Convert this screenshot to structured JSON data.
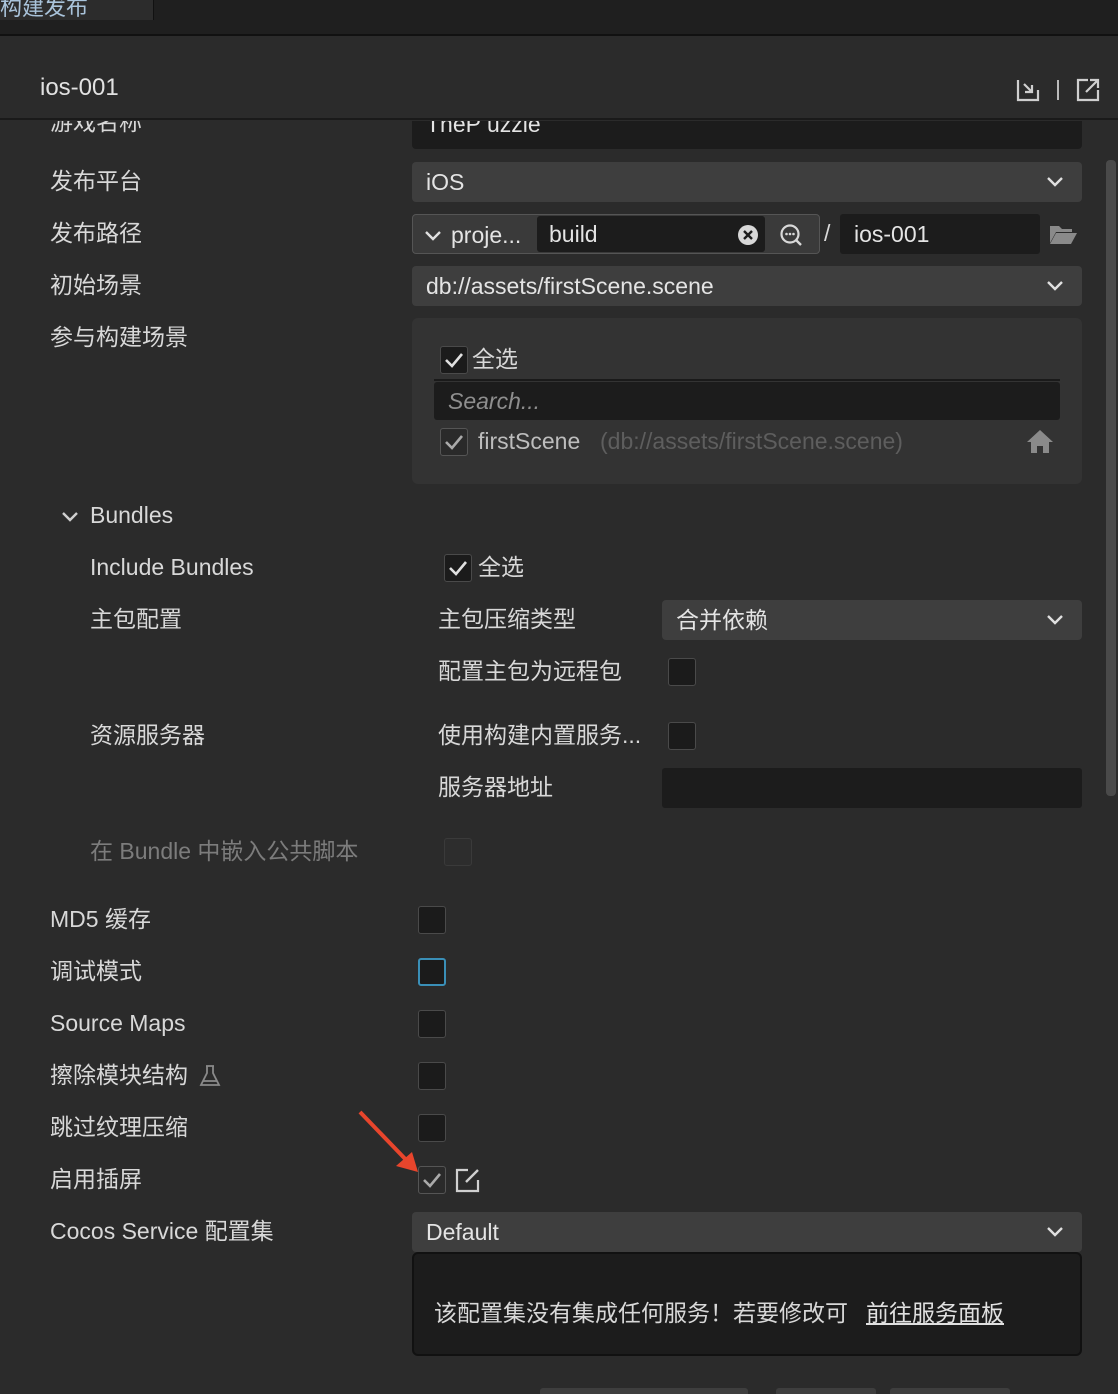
{
  "tab": {
    "label": "构建发布"
  },
  "header": {
    "title": "ios-001"
  },
  "partial_row": {
    "label": "游戏名称",
    "value": "TheP uzzle"
  },
  "platform": {
    "label": "发布平台",
    "value": "iOS"
  },
  "build_path": {
    "label": "发布路径",
    "prefix": "proje...",
    "folder": "build",
    "separator": "/",
    "name": "ios-001"
  },
  "start_scene": {
    "label": "初始场景",
    "value": "db://assets/firstScene.scene"
  },
  "scenes": {
    "label": "参与构建场景",
    "select_all": "全选",
    "search_placeholder": "Search...",
    "items": [
      {
        "name": "firstScene",
        "path": "(db://assets/firstScene.scene)"
      }
    ]
  },
  "bundles": {
    "title": "Bundles",
    "include_label": "Include Bundles",
    "include_select_all": "全选",
    "main_config_label": "主包配置",
    "compression_label": "主包压缩类型",
    "compression_value": "合并依赖",
    "remote_label": "配置主包为远程包",
    "server_label": "资源服务器",
    "builtin_server_label": "使用构建内置服务...",
    "server_addr_label": "服务器地址",
    "server_addr_value": "",
    "embed_label": "在 Bundle 中嵌入公共脚本"
  },
  "options": {
    "md5": "MD5 缓存",
    "debug": "调试模式",
    "source_maps": "Source Maps",
    "erase_modules": "擦除模块结构",
    "skip_texture": "跳过纹理压缩",
    "splash": "启用插屏"
  },
  "cocos_service": {
    "label": "Cocos Service 配置集",
    "value": "Default",
    "message": "该配置集没有集成任何服务！若要修改可",
    "link": "前往服务面板"
  },
  "colors": {
    "background": "#2b2b2b",
    "focus": "#3a8fb7",
    "annotation_arrow": "#e8452c"
  }
}
